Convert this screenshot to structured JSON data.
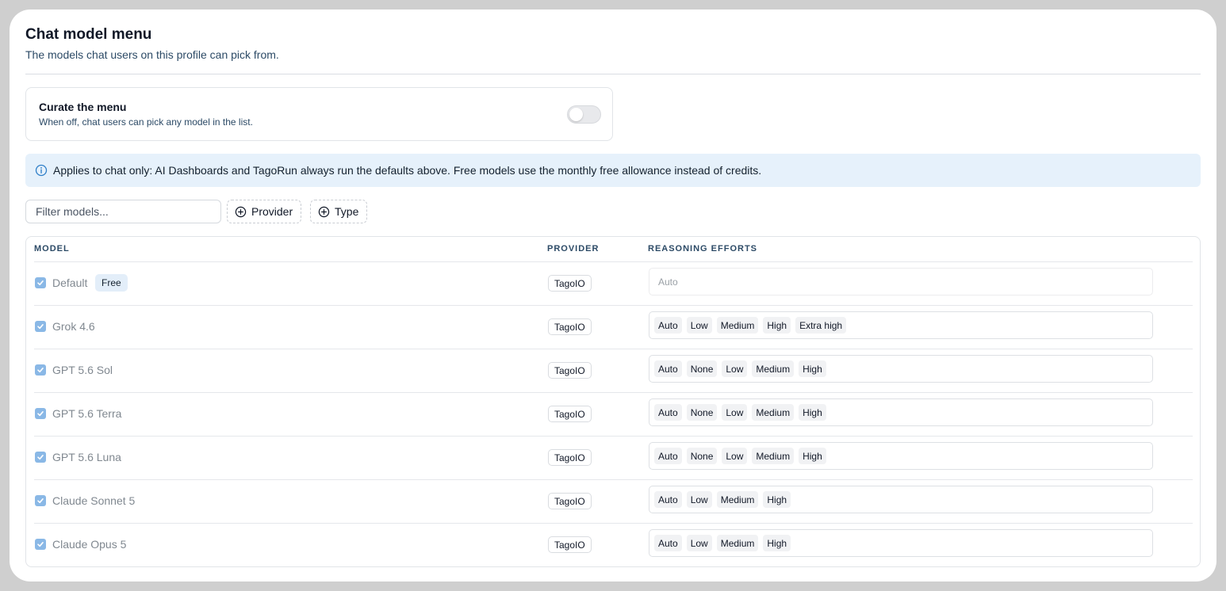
{
  "page": {
    "title": "Chat model menu",
    "subtitle": "The models chat users on this profile can pick from."
  },
  "curate": {
    "title": "Curate the menu",
    "description": "When off, chat users can pick any model in the list.",
    "enabled": false
  },
  "banner": {
    "icon": "info-icon",
    "text": "Applies to chat only: AI Dashboards and TagoRun always run the defaults above. Free models use the monthly free allowance instead of credits."
  },
  "filters": {
    "search_placeholder": "Filter models...",
    "search_value": "",
    "provider_label": "Provider",
    "type_label": "Type"
  },
  "table": {
    "headers": {
      "model": "MODEL",
      "provider": "PROVIDER",
      "efforts": "REASONING EFFORTS"
    },
    "rows": [
      {
        "name": "Default",
        "badge": "Free",
        "provider": "TagoIO",
        "efforts": [],
        "efforts_placeholder": "Auto",
        "checked": true
      },
      {
        "name": "Grok 4.6",
        "provider": "TagoIO",
        "efforts": [
          "Auto",
          "Low",
          "Medium",
          "High",
          "Extra high"
        ],
        "checked": true
      },
      {
        "name": "GPT 5.6 Sol",
        "provider": "TagoIO",
        "efforts": [
          "Auto",
          "None",
          "Low",
          "Medium",
          "High"
        ],
        "checked": true
      },
      {
        "name": "GPT 5.6 Terra",
        "provider": "TagoIO",
        "efforts": [
          "Auto",
          "None",
          "Low",
          "Medium",
          "High"
        ],
        "checked": true
      },
      {
        "name": "GPT 5.6 Luna",
        "provider": "TagoIO",
        "efforts": [
          "Auto",
          "None",
          "Low",
          "Medium",
          "High"
        ],
        "checked": true
      },
      {
        "name": "Claude Sonnet 5",
        "provider": "TagoIO",
        "efforts": [
          "Auto",
          "Low",
          "Medium",
          "High"
        ],
        "checked": true
      },
      {
        "name": "Claude Opus 5",
        "provider": "TagoIO",
        "efforts": [
          "Auto",
          "Low",
          "Medium",
          "High"
        ],
        "checked": true
      }
    ]
  },
  "colors": {
    "accent": "#8ab8e6",
    "banner_bg": "#e6f1fb",
    "subtitle_text": "#2c4a66"
  }
}
